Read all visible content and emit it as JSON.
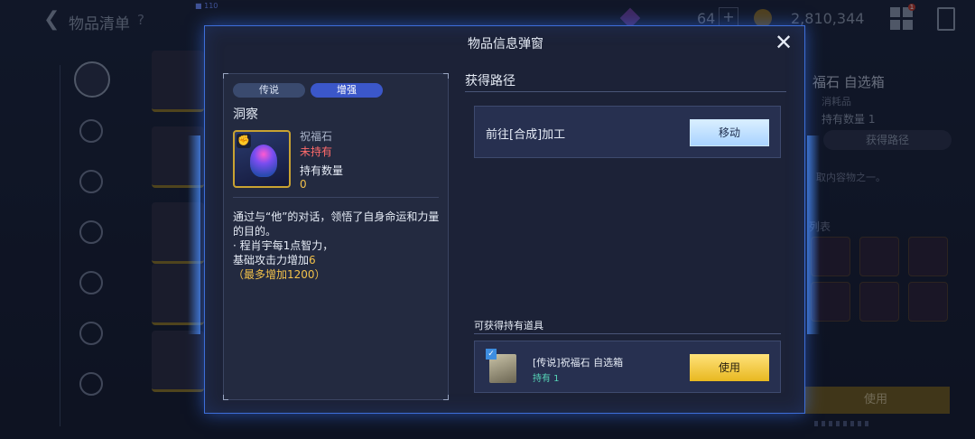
{
  "background": {
    "title": "物品清单",
    "help": "?",
    "back_icon": "back-arrow-icon",
    "gem_count": "64",
    "plus": "+",
    "coin_count": "2,810,344",
    "badge": "1",
    "marker": "■ 110",
    "right_panel": {
      "title": "福石 自选箱",
      "type": "消耗品",
      "own": "持有数量 1",
      "source_button": "获得路径",
      "desc": "取内容物之一。",
      "list_title": "列表",
      "use_button": "使用"
    }
  },
  "modal": {
    "title": "物品信息弹窗",
    "close_icon": "close-icon",
    "info": {
      "tags": [
        "传说",
        "增强"
      ],
      "name": "洞察",
      "item_sub": "祝福石",
      "status": "未持有",
      "own_label": "持有数量",
      "own_value": "0",
      "desc_line1": "通过与“他”的对话，领悟了自身命运和力量的目的。",
      "desc_line2": "· 程肖宇每1点智力，",
      "desc_line3_prefix": "基础攻击力增加",
      "desc_line3_value": "6",
      "desc_line4": "（最多增加1200）"
    },
    "sources": {
      "title": "获得路径",
      "row_label": "前往[合成]加工",
      "move_button": "移动"
    },
    "obtainable": {
      "title": "可获得持有道具",
      "item_name": "[传说]祝福石 自选箱",
      "item_own": "持有 1",
      "use_button": "使用"
    }
  },
  "colors": {
    "accent_blue": "#3d6ed9",
    "enhance_tag": "#3b57c9",
    "not_owned_red": "#ff6b6b",
    "gold": "#f2c14a",
    "owned_teal": "#56d6b8"
  }
}
